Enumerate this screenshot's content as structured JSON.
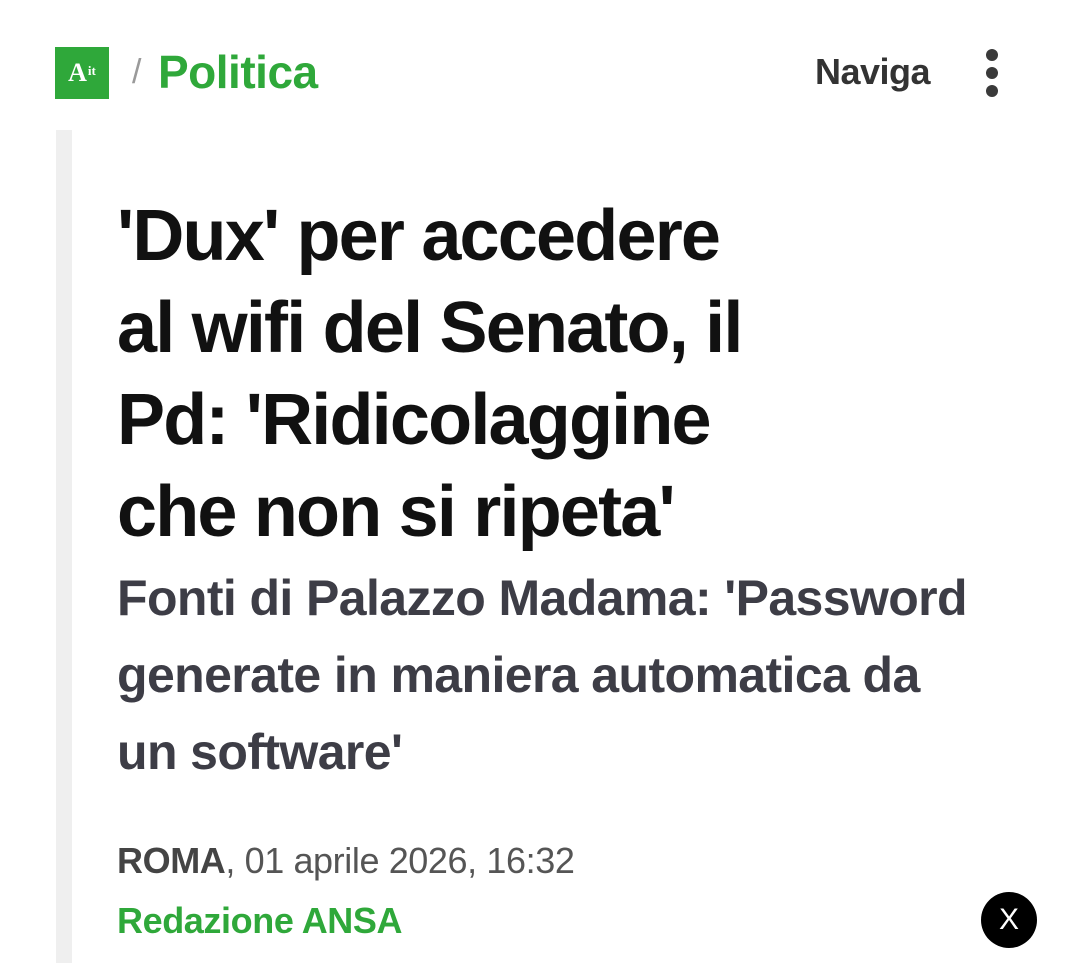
{
  "header": {
    "logo": {
      "main": "A",
      "suffix": "it"
    },
    "breadcrumb_separator": "/",
    "section_label": "Politica",
    "nav_label": "Naviga",
    "menu_icon": "more-vertical-icon"
  },
  "article": {
    "headline_lines": [
      "'Dux' per accedere",
      "al wifi del Senato, il",
      "Pd: 'Ridicolaggine",
      "che non si ripeta'"
    ],
    "subtitle_lines": [
      "Fonti di Palazzo Madama: 'Password",
      "generate in maniera automatica da",
      "un software'"
    ],
    "place": "ROMA",
    "date_text": ", 01 aprile 2026, 16:32",
    "author": "Redazione ANSA"
  },
  "close_button": {
    "label": "X"
  },
  "colors": {
    "brand_green": "#2fa83a",
    "headline": "#111111",
    "subtitle": "#3d3d46",
    "rail": "#efefef"
  }
}
